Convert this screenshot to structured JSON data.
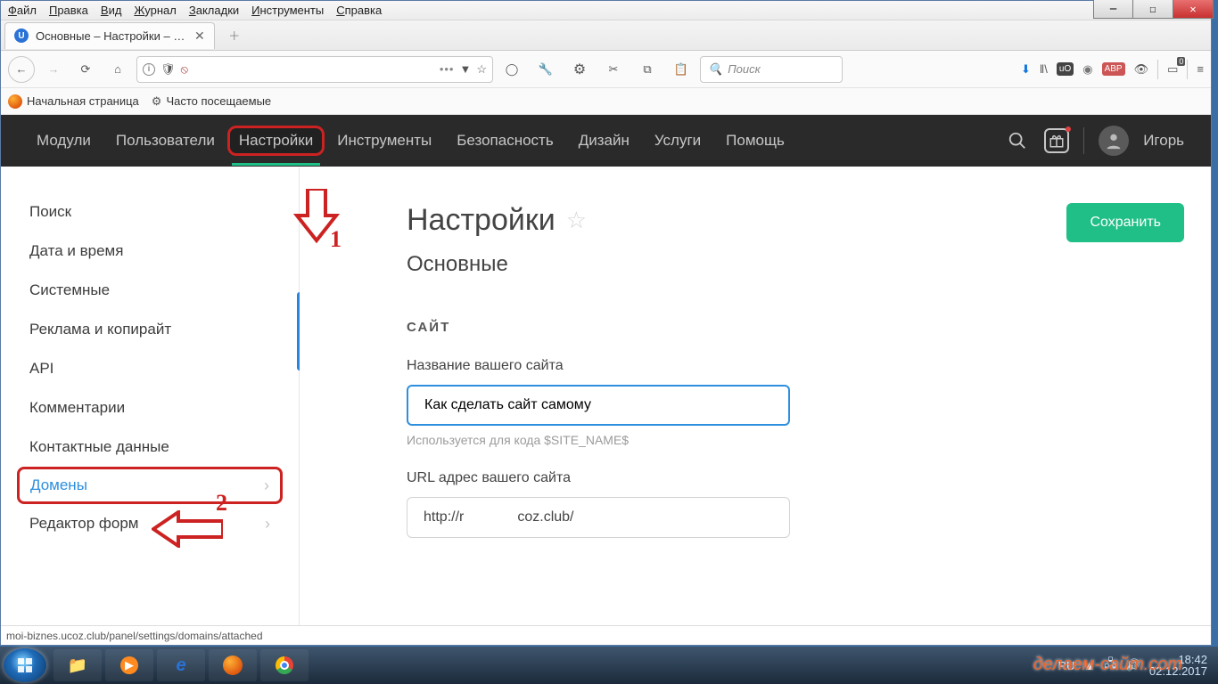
{
  "browser": {
    "menu": [
      "Файл",
      "Правка",
      "Вид",
      "Журнал",
      "Закладки",
      "Инструменты",
      "Справка"
    ],
    "tab_title": "Основные – Настройки – moi…",
    "search_placeholder": "Поиск",
    "bookmarks": {
      "home": "Начальная страница",
      "visited": "Часто посещаемые"
    },
    "status_url": "moi-biznes.ucoz.club/panel/settings/domains/attached",
    "library_badge": "0"
  },
  "ucoz_nav": {
    "items": [
      "Модули",
      "Пользователи",
      "Настройки",
      "Инструменты",
      "Безопасность",
      "Дизайн",
      "Услуги",
      "Помощь"
    ],
    "active_index": 2,
    "username": "Игорь"
  },
  "sidebar": {
    "items": [
      {
        "label": "Поиск",
        "chev": false
      },
      {
        "label": "Дата и время",
        "chev": false
      },
      {
        "label": "Системные",
        "chev": false
      },
      {
        "label": "Реклама и копирайт",
        "chev": false
      },
      {
        "label": "API",
        "chev": false
      },
      {
        "label": "Комментарии",
        "chev": false
      },
      {
        "label": "Контактные данные",
        "chev": false
      },
      {
        "label": "Домены",
        "chev": true,
        "hl": true
      },
      {
        "label": "Редактор форм",
        "chev": true
      }
    ]
  },
  "page": {
    "title": "Настройки",
    "subtitle": "Основные",
    "save": "Сохранить",
    "section": "САЙТ",
    "name_label": "Название вашего сайта",
    "name_value": "Как сделать сайт самому",
    "name_hint": "Используется для кода $SITE_NAME$",
    "url_label": "URL адрес вашего сайта",
    "url_scheme": "http://r",
    "url_domain": "coz.club/"
  },
  "annotations": {
    "n1": "1",
    "n2": "2"
  },
  "taskbar": {
    "lang": "RU",
    "time": "18:42",
    "date": "02.12.2017"
  },
  "watermark": "делаем-сайт.com"
}
